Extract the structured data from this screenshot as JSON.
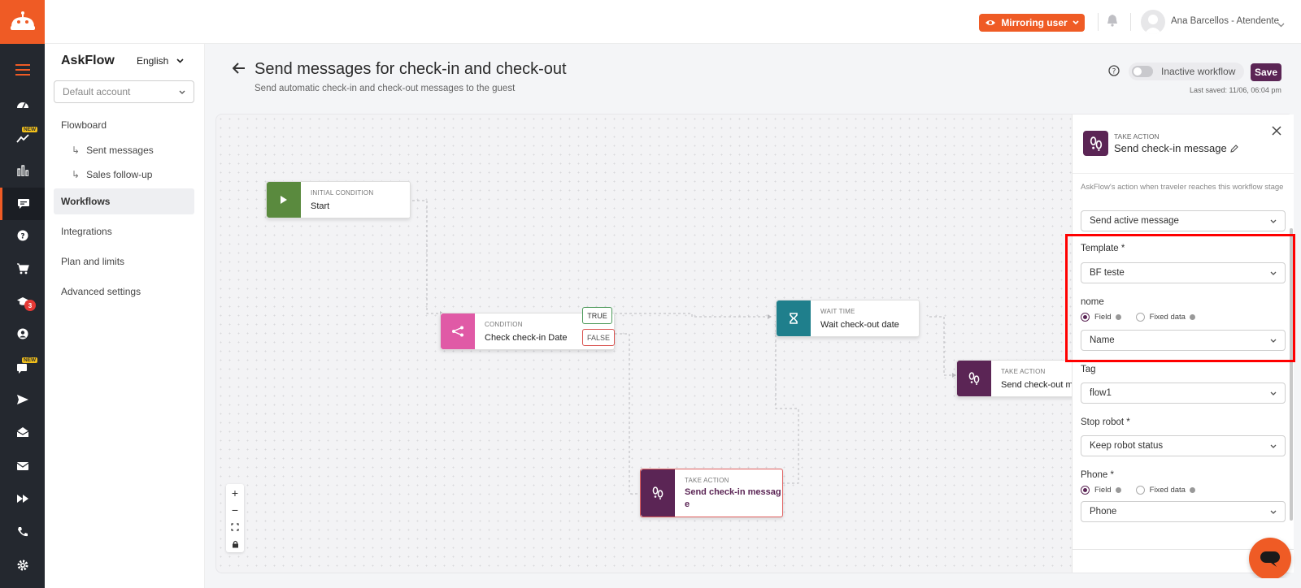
{
  "topbar": {
    "mirror_label": "Mirroring user",
    "user_name": "Ana Barcellos - Atendente"
  },
  "rail": {
    "new_badge": "NEW",
    "count_badge": "3"
  },
  "sidebar": {
    "brand": "AskFlow",
    "language": "English",
    "account_placeholder": "Default account",
    "items": [
      {
        "label": "Flowboard"
      },
      {
        "label": "Sent messages"
      },
      {
        "label": "Sales follow-up"
      },
      {
        "label": "Workflows"
      },
      {
        "label": "Integrations"
      },
      {
        "label": "Plan and limits"
      },
      {
        "label": "Advanced settings"
      }
    ]
  },
  "header": {
    "title": "Send messages for check-in and check-out",
    "subtitle": "Send automatic check-in and check-out messages to the guest",
    "toggle_label": "Inactive workflow",
    "save_label": "Save",
    "last_saved": "Last saved: 11/06, 06:04 pm"
  },
  "flow": {
    "nodes": [
      {
        "type": "INITIAL CONDITION",
        "name": "Start"
      },
      {
        "type": "CONDITION",
        "name": "Check check-in Date"
      },
      {
        "type": "WAIT TIME",
        "name": "Wait check-out date"
      },
      {
        "type": "TAKE ACTION",
        "name": "Send check-out mess"
      },
      {
        "type": "TAKE ACTION",
        "name": "Send check-in messag",
        "name2": "e"
      }
    ],
    "true_label": "TRUE",
    "false_label": "FALSE"
  },
  "panel": {
    "type": "TAKE ACTION",
    "title": "Send check-in message",
    "description": "AskFlow's action when traveler reaches this workflow stage",
    "action_value": "Send active message",
    "template_label": "Template *",
    "template_value": "BF teste",
    "nome_label": "nome",
    "field_label": "Field",
    "fixed_label": "Fixed data",
    "nome_value": "Name",
    "tag_label": "Tag",
    "tag_value": "flow1",
    "stop_label": "Stop robot *",
    "stop_value": "Keep robot status",
    "phone_label": "Phone *",
    "phone_value": "Phone"
  },
  "colors": {
    "brand": "#ef5b25",
    "purple": "#5b2555",
    "green": "#5a8a3e",
    "pink": "#e05aa6",
    "teal": "#1f7f8c"
  }
}
